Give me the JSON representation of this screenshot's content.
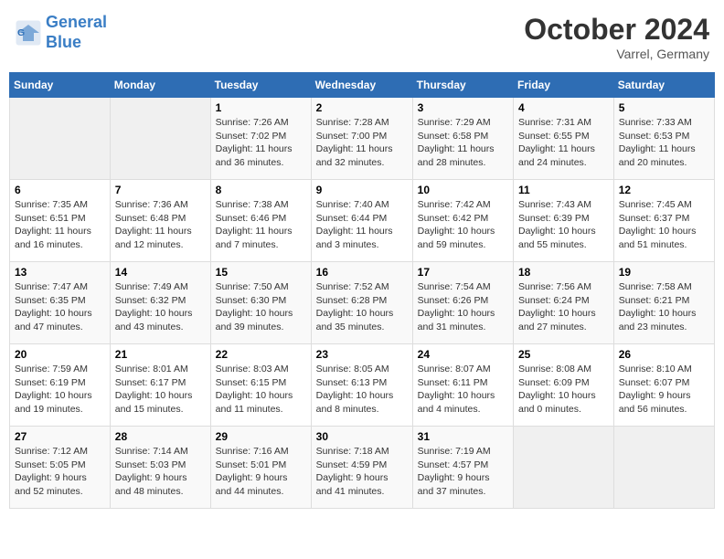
{
  "header": {
    "logo_line1": "General",
    "logo_line2": "Blue",
    "month": "October 2024",
    "location": "Varrel, Germany"
  },
  "weekdays": [
    "Sunday",
    "Monday",
    "Tuesday",
    "Wednesday",
    "Thursday",
    "Friday",
    "Saturday"
  ],
  "weeks": [
    [
      {
        "day": "",
        "content": ""
      },
      {
        "day": "",
        "content": ""
      },
      {
        "day": "1",
        "content": "Sunrise: 7:26 AM\nSunset: 7:02 PM\nDaylight: 11 hours\nand 36 minutes."
      },
      {
        "day": "2",
        "content": "Sunrise: 7:28 AM\nSunset: 7:00 PM\nDaylight: 11 hours\nand 32 minutes."
      },
      {
        "day": "3",
        "content": "Sunrise: 7:29 AM\nSunset: 6:58 PM\nDaylight: 11 hours\nand 28 minutes."
      },
      {
        "day": "4",
        "content": "Sunrise: 7:31 AM\nSunset: 6:55 PM\nDaylight: 11 hours\nand 24 minutes."
      },
      {
        "day": "5",
        "content": "Sunrise: 7:33 AM\nSunset: 6:53 PM\nDaylight: 11 hours\nand 20 minutes."
      }
    ],
    [
      {
        "day": "6",
        "content": "Sunrise: 7:35 AM\nSunset: 6:51 PM\nDaylight: 11 hours\nand 16 minutes."
      },
      {
        "day": "7",
        "content": "Sunrise: 7:36 AM\nSunset: 6:48 PM\nDaylight: 11 hours\nand 12 minutes."
      },
      {
        "day": "8",
        "content": "Sunrise: 7:38 AM\nSunset: 6:46 PM\nDaylight: 11 hours\nand 7 minutes."
      },
      {
        "day": "9",
        "content": "Sunrise: 7:40 AM\nSunset: 6:44 PM\nDaylight: 11 hours\nand 3 minutes."
      },
      {
        "day": "10",
        "content": "Sunrise: 7:42 AM\nSunset: 6:42 PM\nDaylight: 10 hours\nand 59 minutes."
      },
      {
        "day": "11",
        "content": "Sunrise: 7:43 AM\nSunset: 6:39 PM\nDaylight: 10 hours\nand 55 minutes."
      },
      {
        "day": "12",
        "content": "Sunrise: 7:45 AM\nSunset: 6:37 PM\nDaylight: 10 hours\nand 51 minutes."
      }
    ],
    [
      {
        "day": "13",
        "content": "Sunrise: 7:47 AM\nSunset: 6:35 PM\nDaylight: 10 hours\nand 47 minutes."
      },
      {
        "day": "14",
        "content": "Sunrise: 7:49 AM\nSunset: 6:32 PM\nDaylight: 10 hours\nand 43 minutes."
      },
      {
        "day": "15",
        "content": "Sunrise: 7:50 AM\nSunset: 6:30 PM\nDaylight: 10 hours\nand 39 minutes."
      },
      {
        "day": "16",
        "content": "Sunrise: 7:52 AM\nSunset: 6:28 PM\nDaylight: 10 hours\nand 35 minutes."
      },
      {
        "day": "17",
        "content": "Sunrise: 7:54 AM\nSunset: 6:26 PM\nDaylight: 10 hours\nand 31 minutes."
      },
      {
        "day": "18",
        "content": "Sunrise: 7:56 AM\nSunset: 6:24 PM\nDaylight: 10 hours\nand 27 minutes."
      },
      {
        "day": "19",
        "content": "Sunrise: 7:58 AM\nSunset: 6:21 PM\nDaylight: 10 hours\nand 23 minutes."
      }
    ],
    [
      {
        "day": "20",
        "content": "Sunrise: 7:59 AM\nSunset: 6:19 PM\nDaylight: 10 hours\nand 19 minutes."
      },
      {
        "day": "21",
        "content": "Sunrise: 8:01 AM\nSunset: 6:17 PM\nDaylight: 10 hours\nand 15 minutes."
      },
      {
        "day": "22",
        "content": "Sunrise: 8:03 AM\nSunset: 6:15 PM\nDaylight: 10 hours\nand 11 minutes."
      },
      {
        "day": "23",
        "content": "Sunrise: 8:05 AM\nSunset: 6:13 PM\nDaylight: 10 hours\nand 8 minutes."
      },
      {
        "day": "24",
        "content": "Sunrise: 8:07 AM\nSunset: 6:11 PM\nDaylight: 10 hours\nand 4 minutes."
      },
      {
        "day": "25",
        "content": "Sunrise: 8:08 AM\nSunset: 6:09 PM\nDaylight: 10 hours\nand 0 minutes."
      },
      {
        "day": "26",
        "content": "Sunrise: 8:10 AM\nSunset: 6:07 PM\nDaylight: 9 hours\nand 56 minutes."
      }
    ],
    [
      {
        "day": "27",
        "content": "Sunrise: 7:12 AM\nSunset: 5:05 PM\nDaylight: 9 hours\nand 52 minutes."
      },
      {
        "day": "28",
        "content": "Sunrise: 7:14 AM\nSunset: 5:03 PM\nDaylight: 9 hours\nand 48 minutes."
      },
      {
        "day": "29",
        "content": "Sunrise: 7:16 AM\nSunset: 5:01 PM\nDaylight: 9 hours\nand 44 minutes."
      },
      {
        "day": "30",
        "content": "Sunrise: 7:18 AM\nSunset: 4:59 PM\nDaylight: 9 hours\nand 41 minutes."
      },
      {
        "day": "31",
        "content": "Sunrise: 7:19 AM\nSunset: 4:57 PM\nDaylight: 9 hours\nand 37 minutes."
      },
      {
        "day": "",
        "content": ""
      },
      {
        "day": "",
        "content": ""
      }
    ]
  ]
}
